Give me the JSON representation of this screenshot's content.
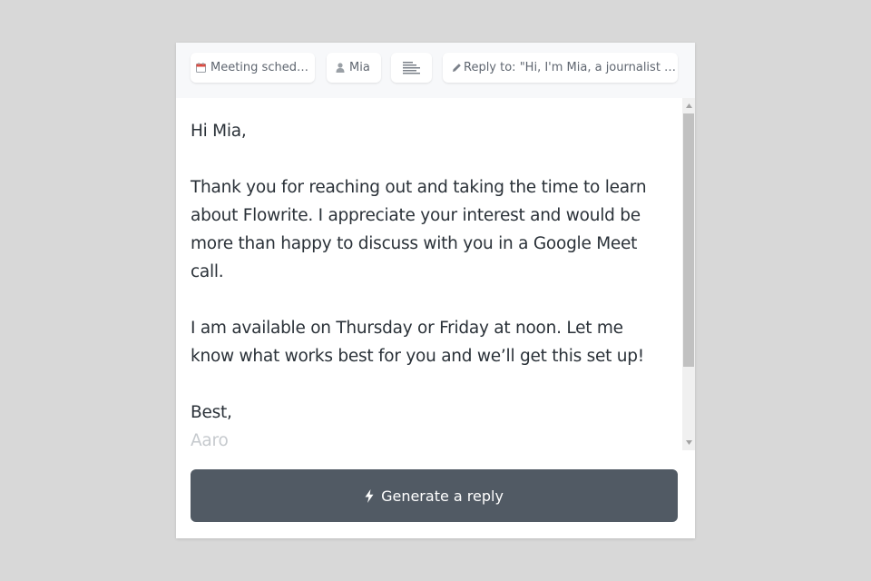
{
  "toolbar": {
    "scheduler_label": "Meeting scheduler",
    "contact_label": "Mia",
    "reply_label": "Reply to: \"Hi, I'm Mia, a journalist fro..."
  },
  "email": {
    "greeting": "Hi Mia,",
    "paragraph_1": "Thank you for reaching out and taking the time to learn about Flowrite. I appreciate your interest and would be more than happy to discuss with you in a Google Meet call.",
    "paragraph_2": "I am available on Thursday or Friday at noon. Let me know what works best for you and we’ll get this set up!",
    "signoff": "Best,",
    "signature": "Aaro"
  },
  "actions": {
    "generate_label": "Generate a reply"
  },
  "icons": {
    "scheduler": "calendar-icon",
    "contact": "person-icon",
    "length": "text-length-icon",
    "reply": "pencil-icon",
    "generate": "lightning-icon"
  },
  "colors": {
    "button_bg": "#515a64",
    "toolbar_bg": "#f7f8fa",
    "calendar_accent": "#e0483e"
  }
}
